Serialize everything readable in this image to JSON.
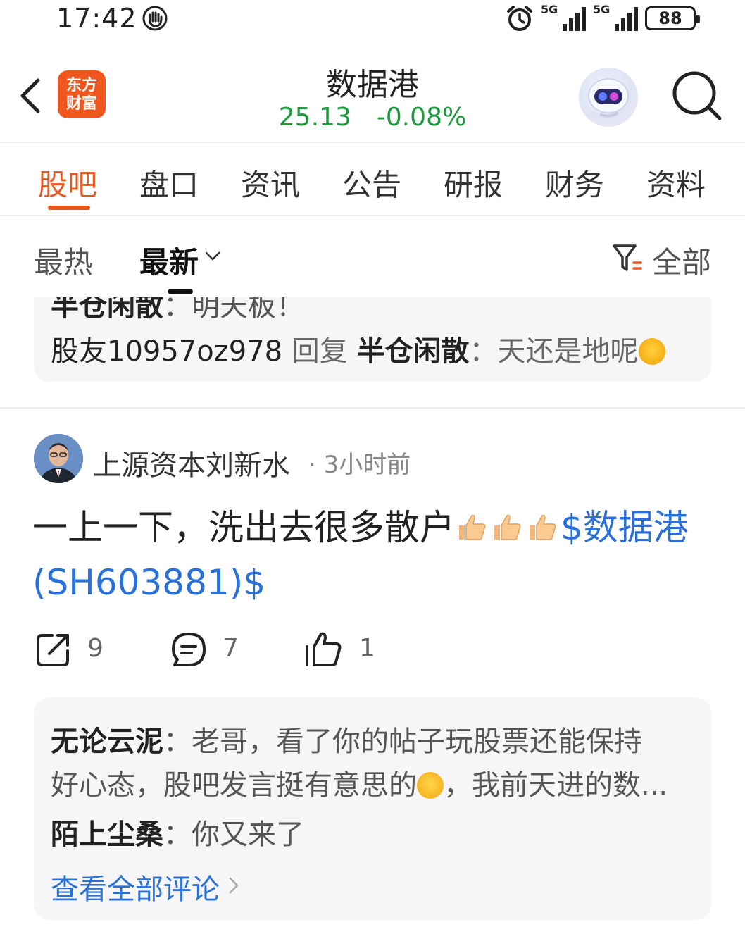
{
  "status_bar": {
    "time": "17:42",
    "signal1_label": "5G",
    "signal2_label": "5G",
    "battery": "88"
  },
  "header": {
    "logo_line1": "东方",
    "logo_line2": "财富",
    "title": "数据港",
    "price": "25.13",
    "change": "-0.08%",
    "price_color": "#1c9a3c"
  },
  "tabs": [
    {
      "label": "股吧",
      "active": true
    },
    {
      "label": "盘口"
    },
    {
      "label": "资讯"
    },
    {
      "label": "公告"
    },
    {
      "label": "研报"
    },
    {
      "label": "财务"
    },
    {
      "label": "资料"
    }
  ],
  "sort": {
    "hot_label": "最热",
    "new_label": "最新",
    "filter_label": "全部"
  },
  "prev_post_comments": {
    "cut_author": "半仓闲散",
    "cut_text": "：明天板",
    "cut_suffix": "！",
    "reply_user": "股友10957oz978",
    "reply_word": "回复",
    "reply_target": "半仓闲散",
    "reply_text": "：天还是地呢"
  },
  "post": {
    "author": "上源资本刘新水",
    "dot": "·",
    "time": "3小时前",
    "body_text": "一上一下，洗出去很多散户",
    "stock_tag": "$数据港(SH603881)$",
    "shares": "9",
    "comments": "7",
    "likes": "1",
    "comment_list": [
      {
        "user": "无论云泥",
        "text_line1": "：老哥，看了你的帖子玩股票还能保持",
        "text_line2a": "好心态，股吧发言挺有意思的",
        "text_line2b": "，我前天进的数..."
      },
      {
        "user": "陌上尘桑",
        "text": "：你又来了"
      }
    ],
    "view_all": "查看全部评论"
  },
  "colors": {
    "accent": "#e8571e",
    "link": "#2970d8"
  }
}
